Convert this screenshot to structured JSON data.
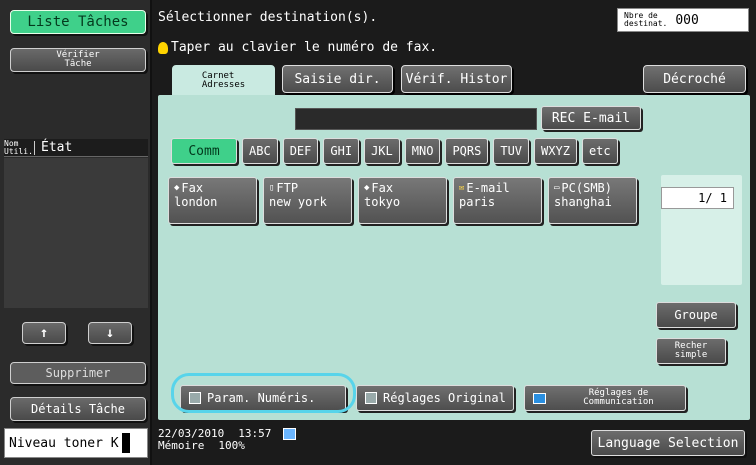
{
  "sidebar": {
    "job_list": "Liste Tâches",
    "check_job_line1": "Vérifier",
    "check_job_line2": "Tâche",
    "col_user_line1": "Nom",
    "col_user_line2": "Utili.",
    "col_status": "État",
    "up_arrow": "↑",
    "down_arrow": "↓",
    "delete": "Supprimer",
    "job_details": "Détails Tâche",
    "toner_label": "Niveau toner",
    "toner_letter": "K"
  },
  "header": {
    "title": "Sélectionner destination(s).",
    "hint": "Taper au clavier le numéro de fax.",
    "dest_count_line1": "Nbre de",
    "dest_count_line2": "destinat.",
    "dest_count_value": "000"
  },
  "tabs": {
    "address_book_line1": "Carnet",
    "address_book_line2": "Adresses",
    "direct_input": "Saisie dir.",
    "history": "Vérif. Histor",
    "off_hook": "Décroché"
  },
  "panel": {
    "rec_email": "REC E-mail",
    "index_tabs": [
      "Comm",
      "ABC",
      "DEF",
      "GHI",
      "JKL",
      "MNO",
      "PQRS",
      "TUV",
      "WXYZ",
      "etc"
    ],
    "destinations": [
      {
        "type": "Fax",
        "name": "london",
        "icon": "fax-icon"
      },
      {
        "type": "FTP",
        "name": "new york",
        "icon": "ftp-icon"
      },
      {
        "type": "Fax",
        "name": "tokyo",
        "icon": "fax-icon"
      },
      {
        "type": "E-mail",
        "name": "paris",
        "icon": "email-icon"
      },
      {
        "type": "PC(SMB)",
        "name": "shanghai",
        "icon": "pc-icon"
      }
    ],
    "page_indicator": "1/ 1",
    "group": "Groupe",
    "search_line1": "Recher",
    "search_line2": "simple",
    "scan_settings": "Param. Numéris.",
    "original_settings": "Réglages Original",
    "comm_settings_line1": "Réglages de",
    "comm_settings_line2": "Communication"
  },
  "footer": {
    "date": "22/03/2010",
    "time": "13:57",
    "memory_label": "Mémoire",
    "memory_value": "100%",
    "language": "Language Selection"
  }
}
